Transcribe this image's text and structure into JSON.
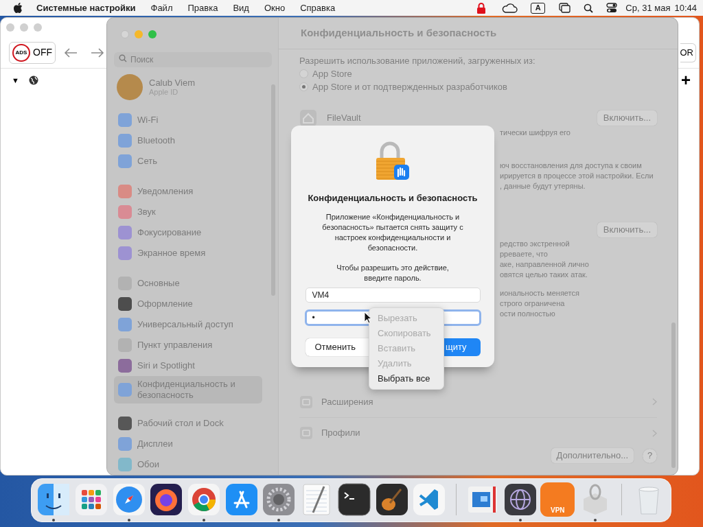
{
  "menu_bar": {
    "app_name": "Системные настройки",
    "menus": [
      "Файл",
      "Правка",
      "Вид",
      "Окно",
      "Справка"
    ],
    "keyboard_indicator": "A",
    "date": "Ср, 31 мая",
    "time": "10:44"
  },
  "browser": {
    "adblock_logo": "ADS",
    "adblock_state": "OFF",
    "expand_marker": "▼",
    "right_button": "OR",
    "add_button": "+"
  },
  "settings": {
    "search": {
      "placeholder": "Поиск"
    },
    "account": {
      "name": "Calub Viem",
      "subtitle": "Apple ID"
    },
    "sidebar_groups": [
      [
        {
          "label": "Wi-Fi",
          "color": "#7fa3d8",
          "selected": false
        },
        {
          "label": "Bluetooth",
          "color": "#7fa3d8",
          "selected": false
        },
        {
          "label": "Сеть",
          "color": "#7fa3d8",
          "selected": false
        }
      ],
      [
        {
          "label": "Уведомления",
          "color": "#d98b85",
          "selected": false
        },
        {
          "label": "Звук",
          "color": "#d98b94",
          "selected": false
        },
        {
          "label": "Фокусирование",
          "color": "#9d92d2",
          "selected": false
        },
        {
          "label": "Экранное время",
          "color": "#9d92d2",
          "selected": false
        }
      ],
      [
        {
          "label": "Основные",
          "color": "#b2b2b2",
          "selected": false
        },
        {
          "label": "Оформление",
          "color": "#4d4d4d",
          "selected": false
        },
        {
          "label": "Универсальный доступ",
          "color": "#7fa3d8",
          "selected": false
        },
        {
          "label": "Пункт управления",
          "color": "#b2b2b2",
          "selected": false
        },
        {
          "label": "Siri и Spotlight",
          "color": "#8c6c9c",
          "selected": false
        },
        {
          "label": "Конфиденциальность и безопасность",
          "color": "#7fa3d8",
          "selected": true
        }
      ],
      [
        {
          "label": "Рабочий стол и Dock",
          "color": "#575757",
          "selected": false
        },
        {
          "label": "Дисплеи",
          "color": "#7fa3d8",
          "selected": false
        },
        {
          "label": "Обои",
          "color": "#82b8ca",
          "selected": false
        }
      ]
    ],
    "title": "Конфиденциальность и безопасность",
    "allow_label": "Разрешить использование приложений, загруженных из:",
    "sources": [
      {
        "label": "App Store",
        "selected": false
      },
      {
        "label": "App Store и от подтвержденных разработчиков",
        "selected": true
      }
    ],
    "filevault": {
      "title": "FileVault",
      "button": "Включить...",
      "paragraphs": [
        [
          "тически шифруя его"
        ],
        [
          "юч восстановления для доступа к своим",
          "ирируется в процессе этой настройки. Если",
          ", данные будут утеряны."
        ]
      ]
    },
    "lockdown": {
      "button": "Включить...",
      "paragraphs": [
        [
          "редство экстренной",
          "рреваете, что",
          "аке, направленной лично",
          "овятся целью таких атак."
        ],
        [
          "иональность меняется",
          "строго ограничена",
          "ости полностью"
        ]
      ]
    },
    "rows": [
      {
        "label": "Расширения"
      },
      {
        "label": "Профили"
      }
    ],
    "advanced_button": "Дополнительно...",
    "help_button": "?"
  },
  "dialog": {
    "title": "Конфиденциальность и безопасность",
    "message": "Приложение «Конфиденциальность и безопасность» пытается снять защиту с настроек конфиденциальности и безопасности.",
    "prompt": "Чтобы разрешить это действие, введите пароль.",
    "username": "VM4",
    "password": "•",
    "cancel": "Отменить",
    "confirm": "щиту"
  },
  "context_menu": [
    {
      "label": "Вырезать",
      "disabled": true
    },
    {
      "label": "Скопировать",
      "disabled": true
    },
    {
      "label": "Вставить",
      "disabled": true
    },
    {
      "label": "Удалить",
      "disabled": true
    },
    {
      "label": "Выбрать все",
      "disabled": false
    }
  ],
  "dock": [
    {
      "kind": "finder",
      "running": true
    },
    {
      "kind": "launchpad",
      "running": false
    },
    {
      "kind": "safari",
      "running": true
    },
    {
      "kind": "firefox",
      "running": false
    },
    {
      "kind": "chrome",
      "running": true
    },
    {
      "kind": "appstore",
      "running": false
    },
    {
      "kind": "settings",
      "running": true
    },
    {
      "kind": "textedit",
      "running": false
    },
    {
      "kind": "terminal",
      "running": false
    },
    {
      "kind": "guitar",
      "running": false
    },
    {
      "kind": "vscode",
      "running": false
    },
    {
      "kind": "separator"
    },
    {
      "kind": "remote",
      "running": false
    },
    {
      "kind": "globe",
      "running": true
    },
    {
      "kind": "vpn",
      "running": false,
      "label": "VPN"
    },
    {
      "kind": "package",
      "running": true
    },
    {
      "kind": "separator"
    },
    {
      "kind": "trash",
      "running": false
    }
  ]
}
